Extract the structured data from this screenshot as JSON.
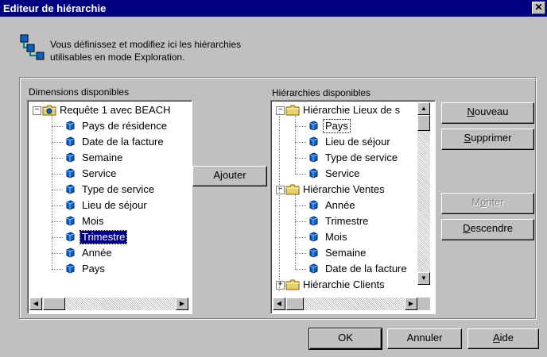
{
  "window": {
    "title": "Editeur de hiérarchie",
    "close_glyph": "✕"
  },
  "description": {
    "line1": "Vous définissez et modifiez ici les hiérarchies",
    "line2": "utilisables en mode Exploration."
  },
  "dimensions": {
    "label": "Dimensions disponibles",
    "root": "Requête 1 avec BEACH",
    "items": [
      "Pays de résidence",
      "Date de la facture",
      "Semaine",
      "Service",
      "Type de service",
      "Lieu de séjour",
      "Mois",
      "Trimestre",
      "Année",
      "Pays"
    ],
    "selected": "Trimestre"
  },
  "hierarchies": {
    "label": "Hiérarchies disponibles",
    "groups": [
      {
        "name": "Hiérarchie Lieux de s",
        "items": [
          "Pays",
          "Lieu de séjour",
          "Type de service",
          "Service"
        ]
      },
      {
        "name": "Hiérarchie Ventes",
        "items": [
          "Année",
          "Trimestre",
          "Mois",
          "Semaine",
          "Date de la facture"
        ]
      },
      {
        "name": "Hiérarchie Clients",
        "items": []
      }
    ],
    "focused": "Pays"
  },
  "buttons": {
    "add": "Ajouter",
    "new": "Nouveau",
    "delete": "Supprimer",
    "up": "Monter",
    "down": "Descendre",
    "ok": "OK",
    "cancel": "Annuler",
    "help": "Aide"
  },
  "icons": {
    "dimension": "dimension-cube-icon",
    "query": "query-folder-icon",
    "hierarchy": "hierarchy-folder-icon"
  },
  "colors": {
    "titlebar": "#000080",
    "face": "#c0c0c0",
    "selection": "#000080",
    "dimension_icon": "#1060c0"
  }
}
